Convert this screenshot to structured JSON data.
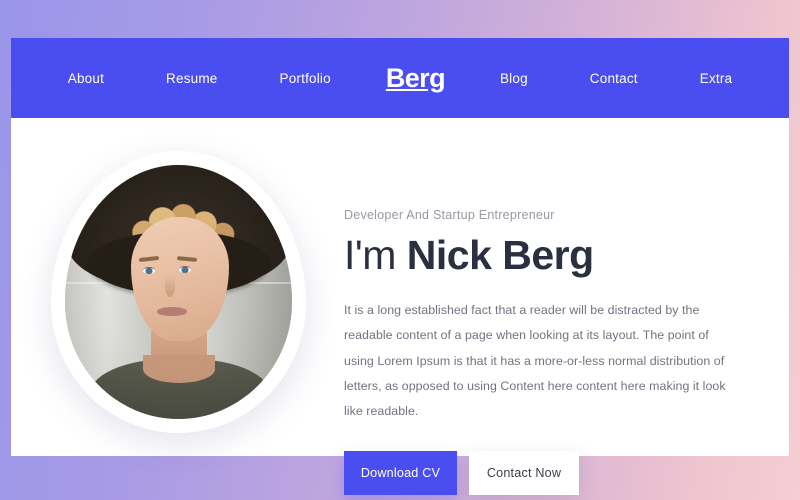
{
  "theme": {
    "accent": "#4a4ef0",
    "page_background": "#ffffff",
    "heading_color": "#2b3040",
    "muted_text_color": "#9699a3",
    "body_text_color": "#6f7480",
    "backdrop_gradient_start": "#9a96ea",
    "backdrop_gradient_end": "#f5cdd2"
  },
  "navbar": {
    "brand": "Berg",
    "left_links": [
      {
        "label": "About"
      },
      {
        "label": "Resume"
      },
      {
        "label": "Portfolio"
      }
    ],
    "right_links": [
      {
        "label": "Blog"
      },
      {
        "label": "Contact"
      },
      {
        "label": "Extra"
      }
    ]
  },
  "hero": {
    "subtitle": "Developer And Startup Entrepreneur",
    "title_prefix": "I'm ",
    "title_name": "Nick Berg",
    "paragraph": "It is a long established fact that a reader will be distracted by the readable content of a page when looking at its layout. The point of using Lorem Ipsum is that it has a more-or-less normal distribution of letters, as opposed to using Content here content here making it look like readable.",
    "primary_button": "Download CV",
    "secondary_button": "Contact Now",
    "portrait_alt": "portrait-photo-of-nick-berg"
  }
}
